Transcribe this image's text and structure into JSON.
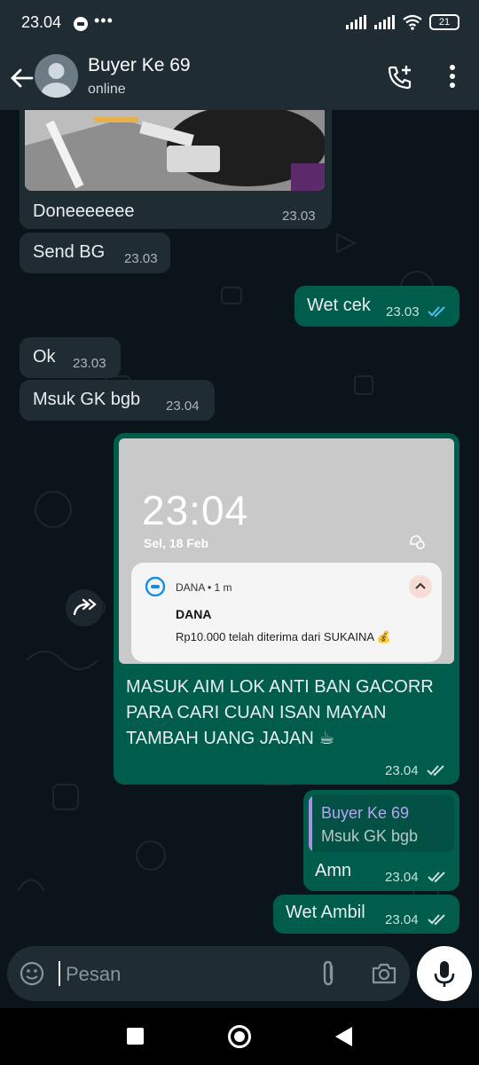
{
  "status_bar": {
    "time": "23.04",
    "battery": "21"
  },
  "header": {
    "name": "Buyer Ke 69",
    "status": "online"
  },
  "messages": [
    {
      "side": "in",
      "text": "Doneeeeeee",
      "time": "23.03"
    },
    {
      "side": "in",
      "text": "Send BG",
      "time": "23.03"
    },
    {
      "side": "out",
      "text": "Wet cek",
      "time": "23.03",
      "read": true
    },
    {
      "side": "in",
      "text": "Ok",
      "time": "23.03"
    },
    {
      "side": "in",
      "text": "Msuk GK bgb",
      "time": "23.04"
    },
    {
      "side": "out",
      "text": "MASUK AIM LOK ANTI BAN GACORR PARA CARI CUAN ISAN MAYAN TAMBAH UANG JAJAN ☕",
      "time": "23.04",
      "read": false
    },
    {
      "side": "out",
      "text": "Amn",
      "time": "23.04",
      "read": false
    },
    {
      "side": "out",
      "text": "Wet Ambil",
      "time": "23.04",
      "read": false
    }
  ],
  "screenshot": {
    "lock_time": "23:04",
    "lock_date": "Sel, 18 Feb",
    "notification": {
      "app": "DANA • 1 m",
      "title": "DANA",
      "body": "Rp10.000 telah diterima dari SUKAINA 💰"
    }
  },
  "reply_quote": {
    "name": "Buyer Ke 69",
    "text": "Msuk GK bgb"
  },
  "input": {
    "placeholder": "Pesan"
  },
  "colors": {
    "incoming": "#202c33",
    "outgoing": "#005c4b",
    "read_tick": "#53bdeb"
  }
}
